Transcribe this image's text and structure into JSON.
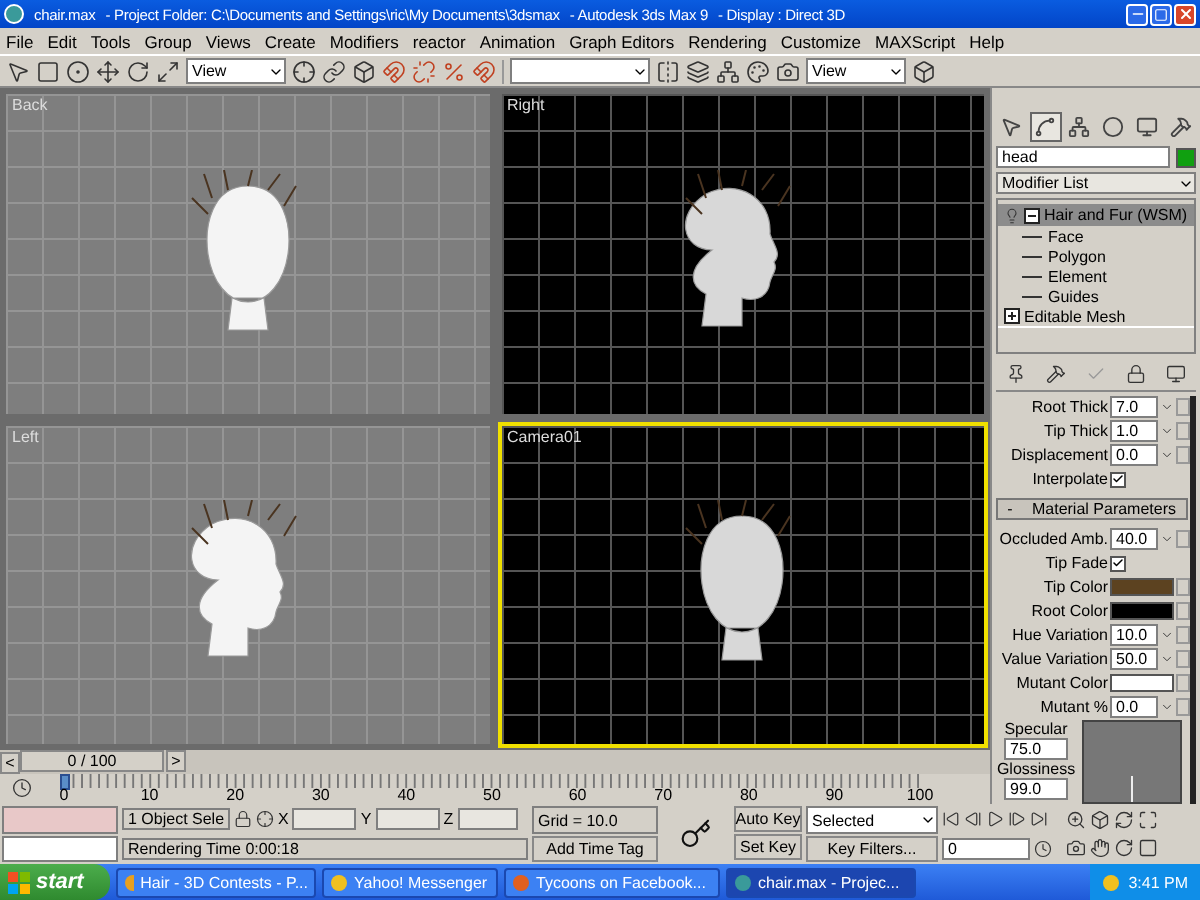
{
  "window": {
    "title_parts": [
      "chair.max",
      "- Project Folder: C:\\Documents and Settings\\ric\\My Documents\\3dsmax",
      "- Autodesk 3ds Max 9",
      "- Display : Direct 3D"
    ]
  },
  "menu": [
    "File",
    "Edit",
    "Tools",
    "Group",
    "Views",
    "Create",
    "Modifiers",
    "reactor",
    "Animation",
    "Graph Editors",
    "Rendering",
    "Customize",
    "MAXScript",
    "Help"
  ],
  "toolbar": {
    "dropdowns": [
      "View",
      "View"
    ]
  },
  "viewports": [
    {
      "label": "Back",
      "dark": false,
      "active": false,
      "kind": "front"
    },
    {
      "label": "Right",
      "dark": true,
      "active": false,
      "kind": "profile"
    },
    {
      "label": "Left",
      "dark": false,
      "active": false,
      "kind": "profile"
    },
    {
      "label": "Camera01",
      "dark": true,
      "active": true,
      "kind": "front"
    }
  ],
  "command_panel": {
    "tabs": [
      {
        "selected": false
      },
      {
        "selected": true
      },
      {
        "selected": false
      },
      {
        "selected": false
      },
      {
        "selected": false
      },
      {
        "selected": false
      }
    ],
    "object_name": "head",
    "modifier_list": "Modifier List",
    "stack": [
      {
        "label": "Hair and Fur (WSM)",
        "kind": "modifier",
        "selected": true,
        "expanded": true,
        "children": [
          {
            "label": "Face"
          },
          {
            "label": "Polygon"
          },
          {
            "label": "Element"
          },
          {
            "label": "Guides"
          }
        ]
      },
      {
        "label": "Editable Mesh",
        "kind": "base_object",
        "selected": false,
        "expanded": false
      }
    ],
    "params": [
      {
        "kind": "spinner",
        "label": "Root Thick",
        "value": "7.0"
      },
      {
        "kind": "spinner",
        "label": "Tip Thick",
        "value": "1.0"
      },
      {
        "kind": "spinner",
        "label": "Displacement",
        "value": "0.0"
      },
      {
        "kind": "checkbox",
        "label": "Interpolate",
        "checked": true
      }
    ],
    "material": {
      "sign": "-",
      "title": "Material Parameters",
      "params": [
        {
          "kind": "spinner",
          "label": "Occluded Amb.",
          "value": "40.0"
        },
        {
          "kind": "checkbox",
          "label": "Tip Fade",
          "checked": true
        },
        {
          "kind": "color",
          "label": "Tip Color",
          "color": "#5c4220"
        },
        {
          "kind": "color",
          "label": "Root Color",
          "color": "#000000"
        },
        {
          "kind": "spinner",
          "label": "Hue Variation",
          "value": "10.0"
        },
        {
          "kind": "spinner",
          "label": "Value Variation",
          "value": "50.0"
        },
        {
          "kind": "color",
          "label": "Mutant Color",
          "color": "#ffffff"
        },
        {
          "kind": "spinner",
          "label": "Mutant %",
          "value": "0.0"
        }
      ],
      "highlight": [
        {
          "label": "Specular",
          "value": "75.0"
        },
        {
          "label": "Glossiness",
          "value": "99.0"
        }
      ]
    }
  },
  "timeline": {
    "prev": "<",
    "frame": "0 / 100",
    "level": 0,
    "next": ">",
    "ticks": [
      "0",
      "10",
      "20",
      "30",
      "40",
      "50",
      "60",
      "70",
      "80",
      "90",
      "100"
    ]
  },
  "status": {
    "selection": "1 Object Sele",
    "x": "X",
    "y": "Y",
    "z": "Z",
    "grid": "Grid = 10.0",
    "prompt": "Rendering Time  0:00:18",
    "add_time_tag": "Add Time Tag"
  },
  "animation": {
    "auto_key": "Auto Key",
    "set_key": "Set Key",
    "key_mode": "Selected",
    "key_filters": "Key Filters...",
    "current_frame": "0"
  },
  "taskbar": {
    "start": "start",
    "tasks": [
      {
        "label": "Hair - 3D Contests - P...",
        "selected": false
      },
      {
        "label": "Yahoo! Messenger",
        "selected": false
      },
      {
        "label": "Tycoons on Facebook...",
        "selected": false
      },
      {
        "label": "chair.max    - Projec...",
        "selected": true
      }
    ],
    "clock": "3:41 PM"
  }
}
